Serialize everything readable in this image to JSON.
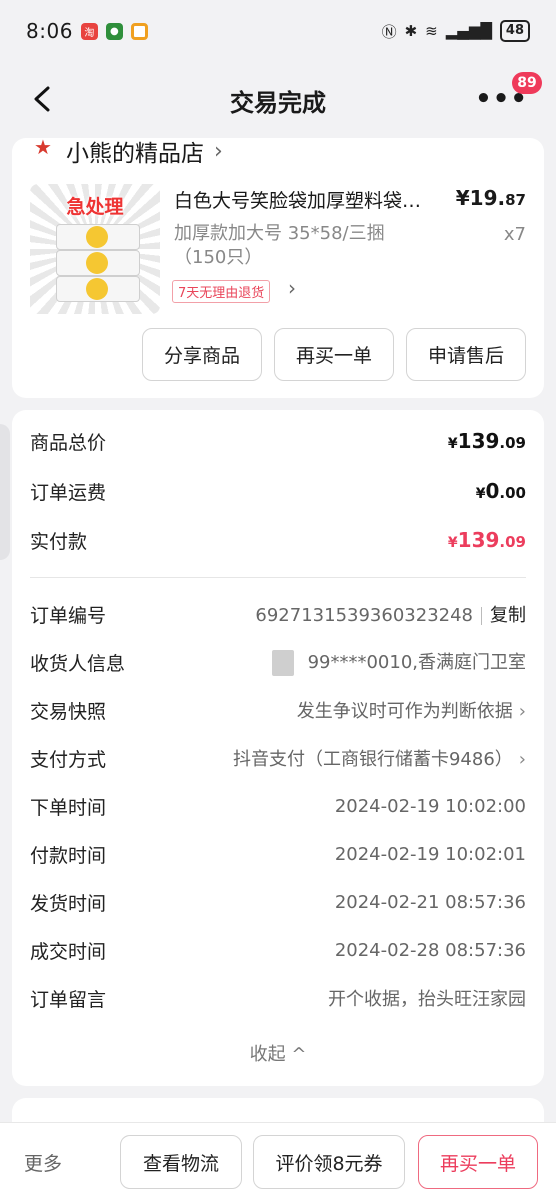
{
  "status_bar": {
    "time": "8:06",
    "battery": "48"
  },
  "nav": {
    "title": "交易完成",
    "badge": "89"
  },
  "shop": {
    "name": "小熊的精品店"
  },
  "product": {
    "title": "白色大号笑脸袋加厚塑料袋…",
    "image_tag": "急处理",
    "price_main": "¥19.",
    "price_dec": "87",
    "spec": "加厚款加大号 35*58/三捆（150只）",
    "qty": "x7",
    "return_tag": "7天无理由退货",
    "buttons": {
      "share": "分享商品",
      "rebuy": "再买一单",
      "aftersale": "申请售后"
    }
  },
  "summary": {
    "goods_total_label": "商品总价",
    "goods_total_cur": "¥",
    "goods_total_int": "139",
    "goods_total_dec": ".09",
    "shipping_label": "订单运费",
    "shipping_cur": "¥",
    "shipping_int": "0",
    "shipping_dec": ".00",
    "paid_label": "实付款",
    "paid_cur": "¥",
    "paid_int": "139",
    "paid_dec": ".09"
  },
  "details": {
    "order_no_label": "订单编号",
    "order_no": "6927131539360323248",
    "copy": "复制",
    "receiver_label": "收货人信息",
    "receiver": "99****0010,香满庭门卫室",
    "snapshot_label": "交易快照",
    "snapshot": "发生争议时可作为判断依据",
    "pay_method_label": "支付方式",
    "pay_method": "抖音支付（工商银行储蓄卡9486）",
    "order_time_label": "下单时间",
    "order_time": "2024-02-19 10:02:00",
    "pay_time_label": "付款时间",
    "pay_time": "2024-02-19 10:02:01",
    "ship_time_label": "发货时间",
    "ship_time": "2024-02-21 08:57:36",
    "deal_time_label": "成交时间",
    "deal_time": "2024-02-28 08:57:36",
    "note_label": "订单留言",
    "note": "开个收据，抬头旺汪家园",
    "collapse": "收起 ^"
  },
  "bottom_bar": {
    "more": "更多",
    "logistics": "查看物流",
    "review": "评价领8元券",
    "rebuy": "再买一单"
  },
  "colors": {
    "accent": "#ec3d5d",
    "background": "#f2f2f4"
  }
}
